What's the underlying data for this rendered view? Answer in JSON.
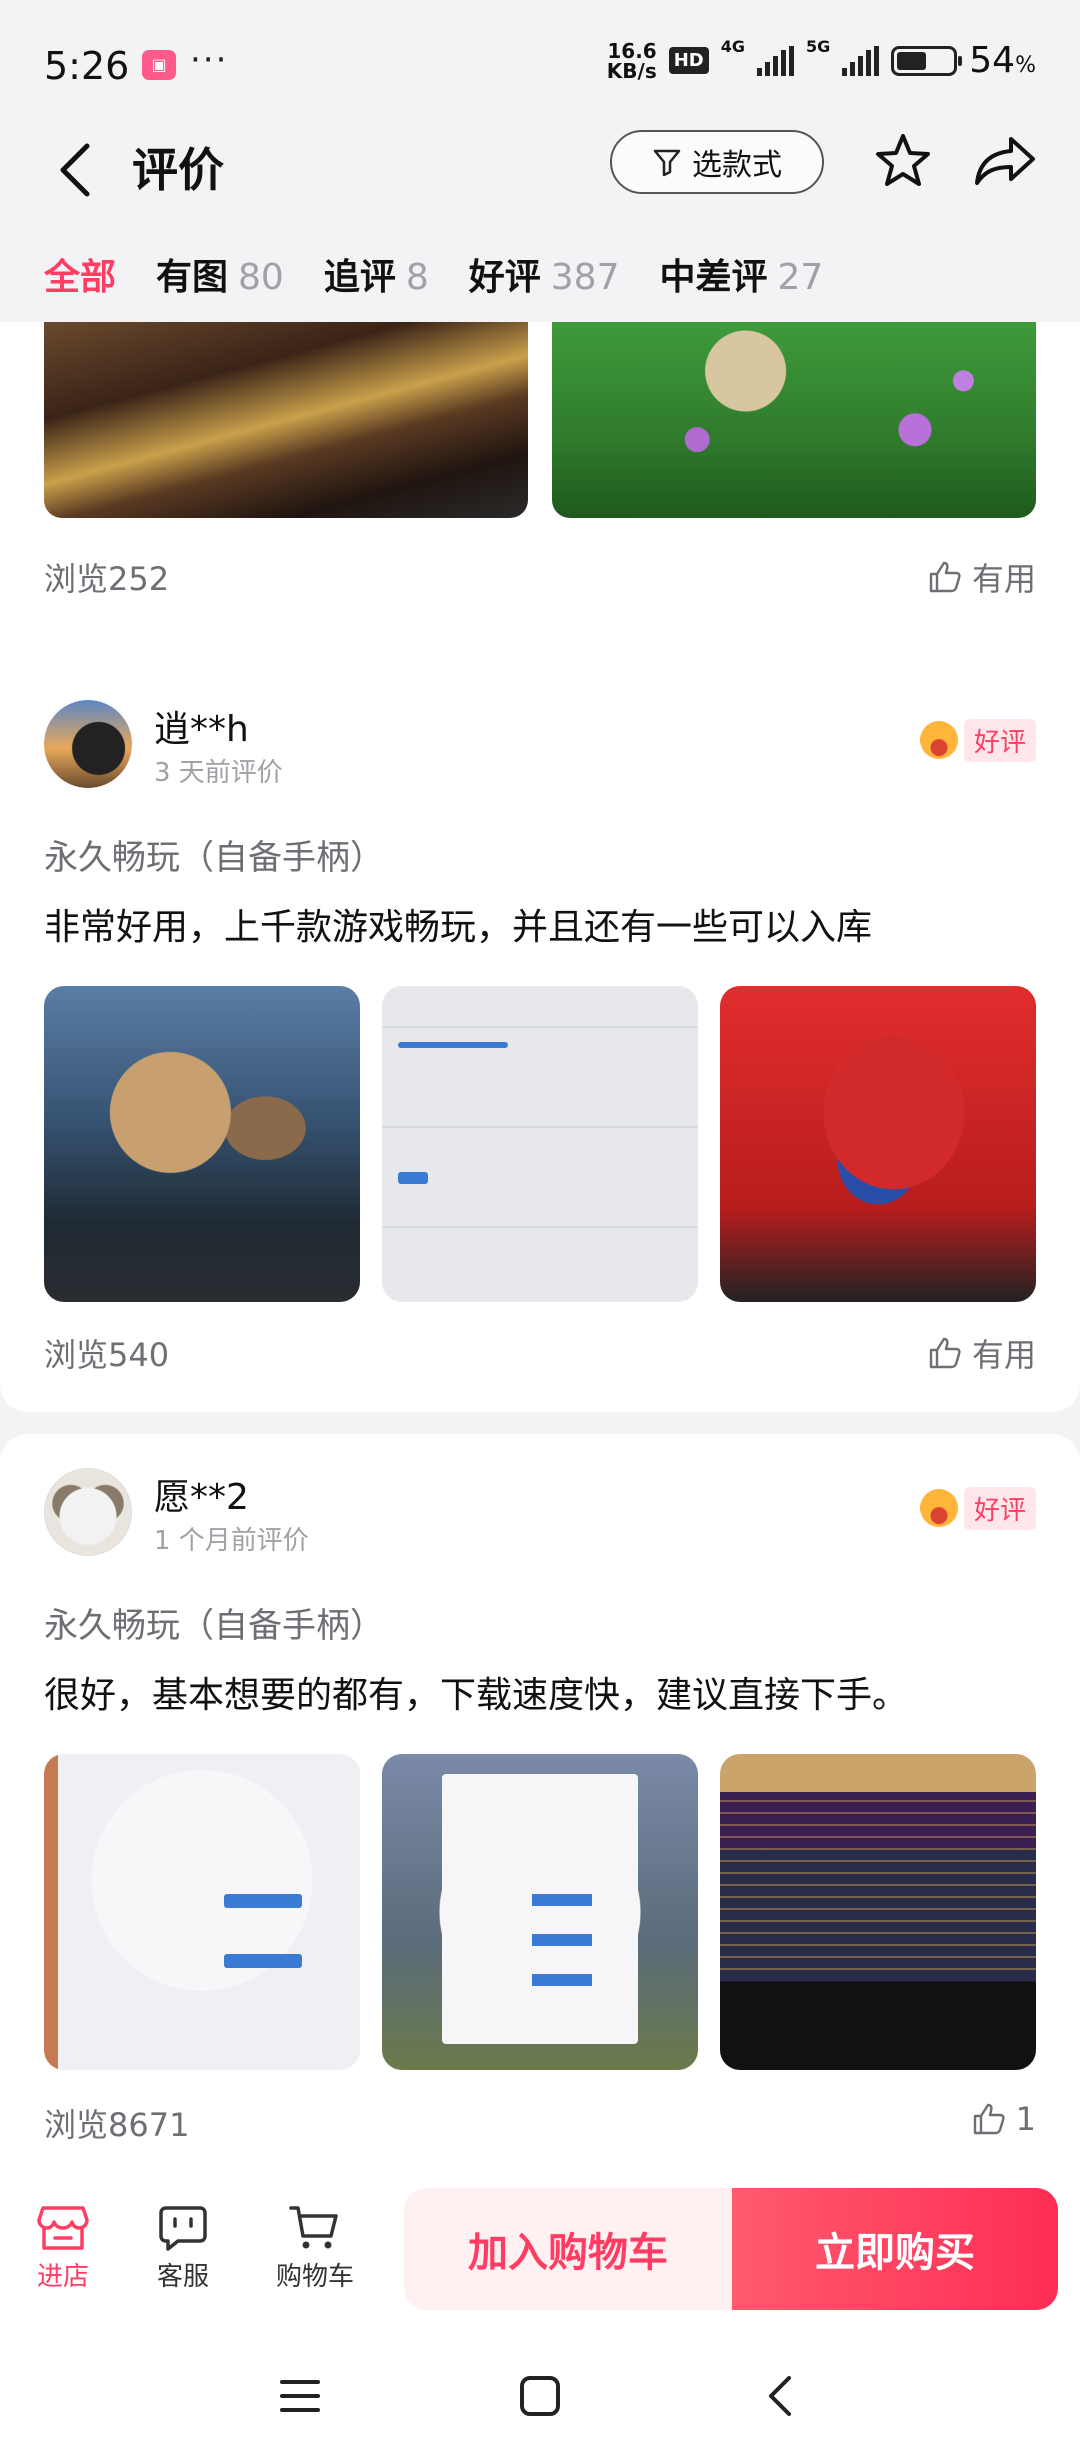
{
  "status_bar": {
    "time": "5:26",
    "speed_value": "16.6",
    "speed_unit": "KB/s",
    "hd": "HD",
    "net1": "4G",
    "net2": "5G",
    "battery_level": 0.54,
    "battery_pct": "54",
    "battery_unit": "%"
  },
  "header": {
    "title": "评价",
    "filter_label": "选款式"
  },
  "tabs": [
    {
      "label": "全部",
      "count": ""
    },
    {
      "label": "有图",
      "count": "80"
    },
    {
      "label": "追评",
      "count": "8"
    },
    {
      "label": "好评",
      "count": "387"
    },
    {
      "label": "中差评",
      "count": "27"
    }
  ],
  "reviews": [
    {
      "views": "浏览252",
      "useful": "有用"
    },
    {
      "user": "逍**h",
      "time": "3 天前评价",
      "badge": "好评",
      "variant": "永久畅玩（自备手柄）",
      "text": "非常好用，上千款游戏畅玩，并且还有一些可以入库",
      "views": "浏览540",
      "useful": "有用"
    },
    {
      "user": "愿**2",
      "time": "1 个月前评价",
      "badge": "好评",
      "variant": "永久畅玩（自备手柄）",
      "text": "很好，基本想要的都有，下载速度快，建议直接下手。",
      "views": "浏览8671",
      "useful": "1"
    }
  ],
  "bottom_bar": {
    "store": "进店",
    "service": "客服",
    "cart": "购物车",
    "add_to_cart": "加入购物车",
    "buy_now": "立即购买"
  },
  "colors": {
    "accent": "#ff3d63",
    "background": "#f3f3f6"
  }
}
